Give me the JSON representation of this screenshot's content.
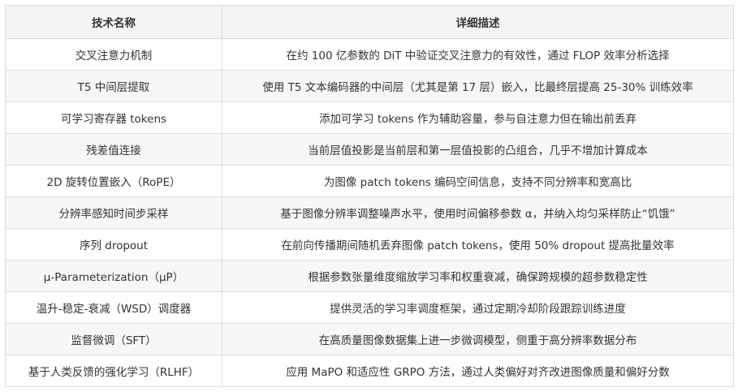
{
  "table": {
    "headers": [
      "技术名称",
      "详细描述"
    ],
    "rows": [
      [
        "交叉注意力机制",
        "在约 100 亿参数的 DiT 中验证交叉注意力的有效性，通过 FLOP 效率分析选择"
      ],
      [
        "T5 中间层提取",
        "使用 T5 文本编码器的中间层（尤其是第 17 层）嵌入，比最终层提高 25-30% 训练效率"
      ],
      [
        "可学习寄存器 tokens",
        "添加可学习 tokens 作为辅助容量，参与自注意力但在输出前丢弃"
      ],
      [
        "残差值连接",
        "当前层值投影是当前层和第一层值投影的凸组合，几乎不增加计算成本"
      ],
      [
        "2D 旋转位置嵌入（RoPE）",
        "为图像 patch tokens 编码空间信息，支持不同分辨率和宽高比"
      ],
      [
        "分辨率感知时间步采样",
        "基于图像分辨率调整噪声水平，使用时间偏移参数 α，并纳入均匀采样防止“饥饿”"
      ],
      [
        "序列 dropout",
        "在前向传播期间随机丢弃图像 patch tokens，使用 50% dropout 提高批量效率"
      ],
      [
        "μ-Parameterization（μP）",
        "根据参数张量维度缩放学习率和权重衰减，确保跨规模的超参数稳定性"
      ],
      [
        "温升-稳定-衰减（WSD）调度器",
        "提供灵活的学习率调度框架，通过定期冷却阶段跟踪训练进度"
      ],
      [
        "监督微调（SFT）",
        "在高质量图像数据集上进一步微调模型，侧重于高分辨率数据分布"
      ],
      [
        "基于人类反馈的强化学习（RLHF）",
        "应用 MaPO 和适应性 GRPO 方法，通过人类偏好对齐改进图像质量和偏好分数"
      ]
    ]
  }
}
